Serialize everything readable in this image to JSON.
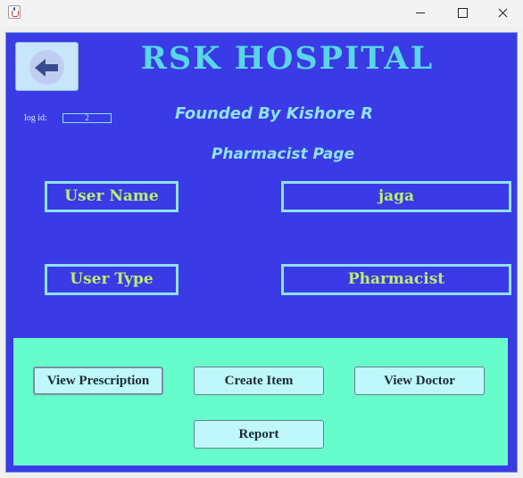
{
  "window": {
    "app_icon": "java-icon",
    "controls": [
      "minimize-icon",
      "maximize-icon",
      "close-icon"
    ]
  },
  "header": {
    "back_icon": "arrow-left-icon",
    "title": "RSK HOSPITAL",
    "founded": "Founded By Kishore R",
    "page_title": "Pharmacist Page"
  },
  "log": {
    "label": "log id:",
    "value": "2"
  },
  "fields": {
    "user_name_label": "User Name",
    "user_name_value": "jaga",
    "user_type_label": "User Type",
    "user_type_value": "Pharmacist"
  },
  "actions": {
    "view_prescription": "View Prescription",
    "create_item": "Create Item",
    "view_doctor": "View Doctor",
    "report": "Report"
  },
  "colors": {
    "background": "#3a3ae6",
    "title": "#58d7e6",
    "label": "#b9ef71",
    "panel": "#66fccb",
    "button": "#bff8fb"
  }
}
